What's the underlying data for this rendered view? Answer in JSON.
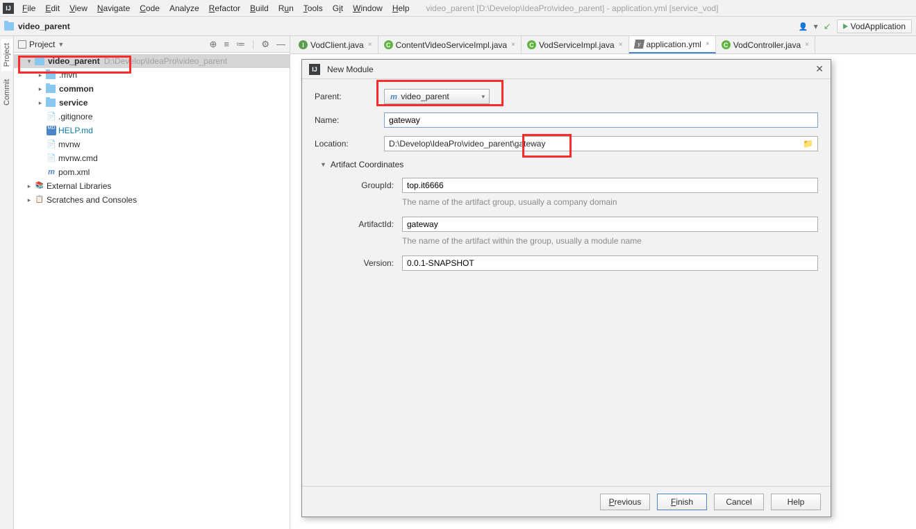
{
  "window": {
    "title": "video_parent [D:\\Develop\\IdeaPro\\video_parent] - application.yml [service_vod]"
  },
  "menu": {
    "file": "File",
    "edit": "Edit",
    "view": "View",
    "navigate": "Navigate",
    "code": "Code",
    "analyze": "Analyze",
    "refactor": "Refactor",
    "build": "Build",
    "run": "Run",
    "tools": "Tools",
    "git": "Git",
    "window": "Window",
    "help": "Help"
  },
  "breadcrumb": {
    "root": "video_parent"
  },
  "run_config": {
    "name": "VodApplication"
  },
  "sidetabs": {
    "project": "Project",
    "commit": "Commit"
  },
  "project_panel": {
    "title": "Project",
    "root": {
      "name": "video_parent",
      "path": "D:\\Develop\\IdeaPro\\video_parent"
    },
    "children": {
      "mvn": ".mvn",
      "common": "common",
      "service": "service",
      "gitignore": ".gitignore",
      "help": "HELP.md",
      "mvnw": "mvnw",
      "mvnwcmd": "mvnw.cmd",
      "pom": "pom.xml"
    },
    "external": "External Libraries",
    "scratches": "Scratches and Consoles"
  },
  "tabs": {
    "t0": "VodClient.java",
    "t1": "ContentVideoServiceImpl.java",
    "t2": "VodServiceImpl.java",
    "t3": "application.yml",
    "t4": "VodController.java"
  },
  "dialog": {
    "title": "New Module",
    "labels": {
      "parent": "Parent:",
      "name": "Name:",
      "location": "Location:",
      "artifact": "Artifact Coordinates",
      "groupId": "GroupId:",
      "artifactId": "ArtifactId:",
      "version": "Version:"
    },
    "values": {
      "parent": "video_parent",
      "name": "gateway",
      "location": "D:\\Develop\\IdeaPro\\video_parent\\gateway",
      "groupId": "top.it6666",
      "artifactId": "gateway",
      "version": "0.0.1-SNAPSHOT"
    },
    "hints": {
      "group": "The name of the artifact group, usually a company domain",
      "artifact": "The name of the artifact within the group, usually a module name"
    },
    "buttons": {
      "previous": "Previous",
      "finish": "Finish",
      "cancel": "Cancel",
      "help": "Help"
    }
  }
}
